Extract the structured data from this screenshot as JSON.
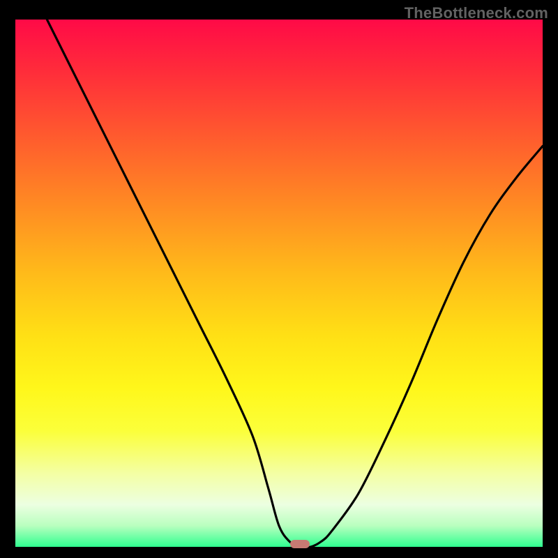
{
  "watermark": "TheBottleneck.com",
  "chart_data": {
    "type": "line",
    "title": "",
    "xlabel": "",
    "ylabel": "",
    "xlim": [
      0,
      100
    ],
    "ylim": [
      0,
      100
    ],
    "series": [
      {
        "name": "curve",
        "x": [
          6,
          10,
          15,
          20,
          25,
          30,
          35,
          40,
          45,
          48,
          50,
          52,
          54,
          56,
          58,
          60,
          65,
          70,
          75,
          80,
          85,
          90,
          95,
          100
        ],
        "y": [
          100,
          92,
          82,
          72,
          62,
          52,
          42,
          32,
          21,
          11,
          4,
          1,
          0,
          0,
          1,
          3,
          10,
          20,
          31,
          43,
          54,
          63,
          70,
          76
        ]
      }
    ],
    "marker": {
      "x": 54,
      "y": 0.5,
      "color": "#c77a73"
    },
    "gradient_stops": [
      {
        "pos": 0.0,
        "color": "#ff0a47"
      },
      {
        "pos": 0.5,
        "color": "#ffd41a"
      },
      {
        "pos": 0.8,
        "color": "#fbff3a"
      },
      {
        "pos": 1.0,
        "color": "#2fff90"
      }
    ]
  }
}
